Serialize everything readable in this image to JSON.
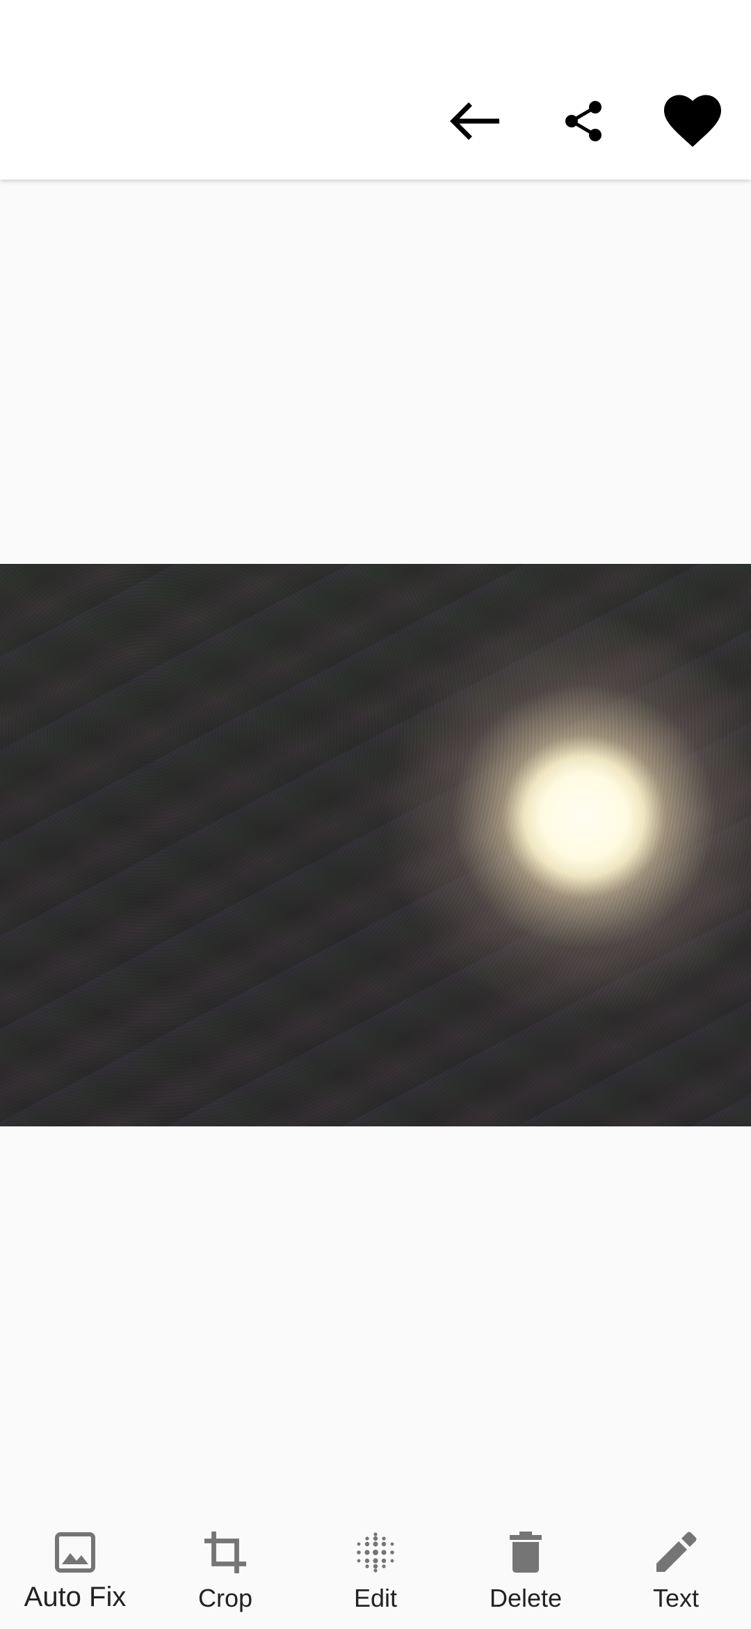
{
  "top_bar": {
    "actions": [
      {
        "name": "back",
        "icon": "arrow-left-icon"
      },
      {
        "name": "share",
        "icon": "share-icon"
      },
      {
        "name": "favorite",
        "icon": "heart-icon"
      }
    ]
  },
  "photo": {
    "description_icon": "photo"
  },
  "bottom_toolbar": {
    "items": [
      {
        "label": "Auto Fix",
        "icon": "image-icon"
      },
      {
        "label": "Crop",
        "icon": "crop-icon"
      },
      {
        "label": "Edit",
        "icon": "dots-grid-icon"
      },
      {
        "label": "Delete",
        "icon": "trash-icon"
      },
      {
        "label": "Text",
        "icon": "pencil-icon"
      }
    ]
  },
  "colors": {
    "icon_dark": "#000000",
    "toolbar_icon": "#757575",
    "label": "#222222",
    "background": "#fafafa"
  }
}
